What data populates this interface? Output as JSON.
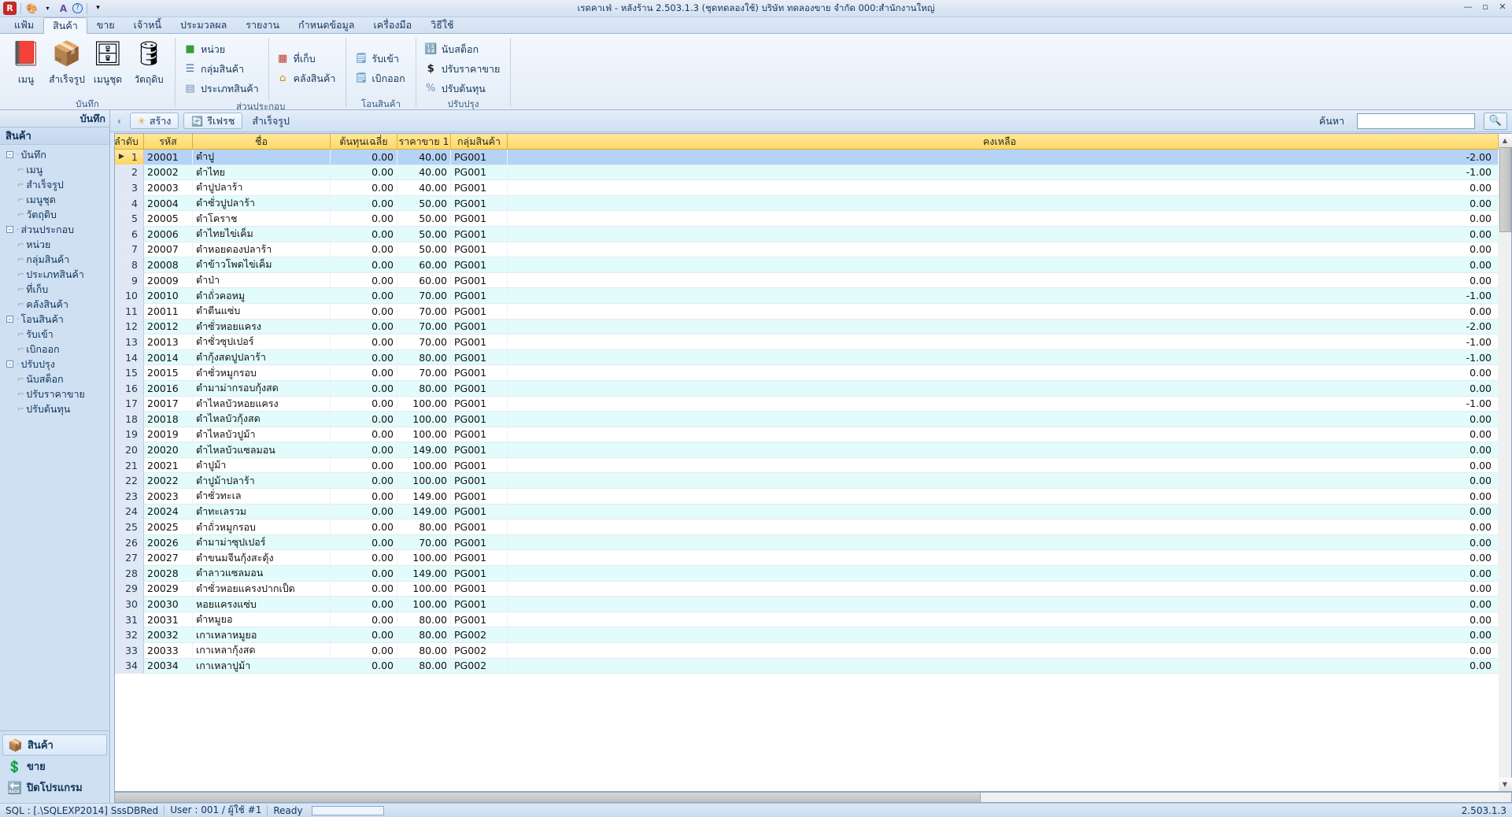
{
  "window": {
    "title": "เรดคาเฟ่ - หลังร้าน 2.503.1.3 (ชุดทดลองใช้) บริษัท ทดลองขาย จำกัด 000:สำนักงานใหญ่",
    "minimize": "—",
    "maximize": "▫",
    "close": "✕"
  },
  "quick_access": {
    "app_icon": "R",
    "items": [
      {
        "name": "palette-icon",
        "glyph": "🎨"
      },
      {
        "name": "dropdown-arrow-icon",
        "glyph": "▾"
      },
      {
        "name": "font-icon",
        "glyph": "A"
      },
      {
        "name": "help-icon",
        "glyph": "?"
      },
      {
        "name": "customize-qat-icon",
        "glyph": "▾"
      }
    ]
  },
  "ribbon": {
    "tabs": [
      {
        "label": "แฟ้ม",
        "active": false
      },
      {
        "label": "สินค้า",
        "active": true
      },
      {
        "label": "ขาย",
        "active": false
      },
      {
        "label": "เจ้าหนี้",
        "active": false
      },
      {
        "label": "ประมวลผล",
        "active": false
      },
      {
        "label": "รายงาน",
        "active": false
      },
      {
        "label": "กำหนดข้อมูล",
        "active": false
      },
      {
        "label": "เครื่องมือ",
        "active": false
      },
      {
        "label": "วิธีใช้",
        "active": false
      }
    ],
    "groups": [
      {
        "label": "บันทึก",
        "big_buttons": [
          {
            "label": "เมนู",
            "icon": "book-icon",
            "glyph": "📕"
          },
          {
            "label": "สำเร็จรูป",
            "icon": "box-icon",
            "glyph": "📦"
          },
          {
            "label": "เมนูชุด",
            "icon": "cabinet-icon",
            "glyph": "🗄"
          },
          {
            "label": "วัตถุดิบ",
            "icon": "cylinder-icon",
            "glyph": "🛢"
          }
        ]
      },
      {
        "label": "ส่วนประกอบ",
        "columns": [
          [
            {
              "label": "หน่วย",
              "icon": "green-square-icon",
              "glyph": "🟩"
            },
            {
              "label": "กลุ่มสินค้า",
              "icon": "list-icon",
              "glyph": "☷"
            },
            {
              "label": "ประเภทสินค้า",
              "icon": "document-list-icon",
              "glyph": "📄"
            }
          ],
          [
            {
              "label": "ที่เก็บ",
              "icon": "warehouse-icon",
              "glyph": "🏭"
            },
            {
              "label": "คลังสินค้า",
              "icon": "house-icon",
              "glyph": "🏠"
            }
          ]
        ]
      },
      {
        "label": "โอนสินค้า",
        "columns": [
          [
            {
              "label": "รับเข้า",
              "icon": "receive-icon",
              "glyph": "📝"
            },
            {
              "label": "เบิกออก",
              "icon": "issue-icon",
              "glyph": "📝"
            }
          ]
        ]
      },
      {
        "label": "ปรับปรุง",
        "columns": [
          [
            {
              "label": "นับสต็อก",
              "icon": "counter-icon",
              "glyph": "🔢"
            },
            {
              "label": "ปรับราคาขาย",
              "icon": "dollar-icon",
              "glyph": "$"
            },
            {
              "label": "ปรับต้นทุน",
              "icon": "percent-icon",
              "glyph": "%"
            }
          ]
        ]
      }
    ]
  },
  "sidebar": {
    "header": "บันทึก",
    "collapse_icon": "‹",
    "title": "สินค้า",
    "tree": [
      {
        "label": "บันทึก",
        "level": 0,
        "expander": "-"
      },
      {
        "label": "เมนู",
        "level": 1
      },
      {
        "label": "สำเร็จรูป",
        "level": 1
      },
      {
        "label": "เมนูชุด",
        "level": 1
      },
      {
        "label": "วัตถุดิบ",
        "level": 1
      },
      {
        "label": "ส่วนประกอบ",
        "level": 0,
        "expander": "-"
      },
      {
        "label": "หน่วย",
        "level": 1
      },
      {
        "label": "กลุ่มสินค้า",
        "level": 1
      },
      {
        "label": "ประเภทสินค้า",
        "level": 1
      },
      {
        "label": "ที่เก็บ",
        "level": 1
      },
      {
        "label": "คลังสินค้า",
        "level": 1
      },
      {
        "label": "โอนสินค้า",
        "level": 0,
        "expander": "-"
      },
      {
        "label": "รับเข้า",
        "level": 1
      },
      {
        "label": "เบิกออก",
        "level": 1
      },
      {
        "label": "ปรับปรุง",
        "level": 0,
        "expander": "-"
      },
      {
        "label": "นับสต็อก",
        "level": 1
      },
      {
        "label": "ปรับราคาขาย",
        "level": 1
      },
      {
        "label": "ปรับต้นทุน",
        "level": 1
      }
    ],
    "bottom_buttons": [
      {
        "label": "สินค้า",
        "icon": "box-icon",
        "glyph": "📦",
        "selected": true
      },
      {
        "label": "ขาย",
        "icon": "dollar-coin-icon",
        "glyph": "💲",
        "selected": false
      },
      {
        "label": "ปิดโปรแกรม",
        "icon": "exit-icon",
        "glyph": "🔙",
        "selected": false
      }
    ]
  },
  "toolbar": {
    "collapse_icon": "‹",
    "create_label": "สร้าง",
    "create_icon": "star-icon",
    "create_glyph": "✳",
    "refresh_label": "รีเฟรช",
    "refresh_icon": "refresh-icon",
    "refresh_glyph": "🔄",
    "context_label": "สำเร็จรูป",
    "search_label": "ค้นหา",
    "search_value": "",
    "search_placeholder": "",
    "search_button_icon": "magnifier-icon",
    "search_button_glyph": "🔍"
  },
  "grid": {
    "columns": [
      {
        "key": "idx",
        "label": "ลำดับ"
      },
      {
        "key": "code",
        "label": "รหัส"
      },
      {
        "key": "name",
        "label": "ชื่อ"
      },
      {
        "key": "cost",
        "label": "ต้นทุนเฉลี่ย"
      },
      {
        "key": "price",
        "label": "ราคาขาย 1"
      },
      {
        "key": "group",
        "label": "กลุ่มสินค้า"
      },
      {
        "key": "stock",
        "label": "คงเหลือ"
      }
    ],
    "rows": [
      {
        "idx": "1",
        "code": "20001",
        "name": "ตำปู",
        "cost": "0.00",
        "price": "40.00",
        "group": "PG001",
        "stock": "-2.00",
        "selected": true
      },
      {
        "idx": "2",
        "code": "20002",
        "name": "ตำไทย",
        "cost": "0.00",
        "price": "40.00",
        "group": "PG001",
        "stock": "-1.00"
      },
      {
        "idx": "3",
        "code": "20003",
        "name": "ตำปูปลาร้า",
        "cost": "0.00",
        "price": "40.00",
        "group": "PG001",
        "stock": "0.00"
      },
      {
        "idx": "4",
        "code": "20004",
        "name": "ตำซั่วปูปลาร้า",
        "cost": "0.00",
        "price": "50.00",
        "group": "PG001",
        "stock": "0.00"
      },
      {
        "idx": "5",
        "code": "20005",
        "name": "ตำโคราช",
        "cost": "0.00",
        "price": "50.00",
        "group": "PG001",
        "stock": "0.00"
      },
      {
        "idx": "6",
        "code": "20006",
        "name": "ตำไทยไข่เค็ม",
        "cost": "0.00",
        "price": "50.00",
        "group": "PG001",
        "stock": "0.00"
      },
      {
        "idx": "7",
        "code": "20007",
        "name": "ตำหอยดองปลาร้า",
        "cost": "0.00",
        "price": "50.00",
        "group": "PG001",
        "stock": "0.00"
      },
      {
        "idx": "8",
        "code": "20008",
        "name": "ตำข้าวโพดไข่เค็ม",
        "cost": "0.00",
        "price": "60.00",
        "group": "PG001",
        "stock": "0.00"
      },
      {
        "idx": "9",
        "code": "20009",
        "name": "ตำป่า",
        "cost": "0.00",
        "price": "60.00",
        "group": "PG001",
        "stock": "0.00"
      },
      {
        "idx": "10",
        "code": "20010",
        "name": "ตำถั่วคอหมู",
        "cost": "0.00",
        "price": "70.00",
        "group": "PG001",
        "stock": "-1.00"
      },
      {
        "idx": "11",
        "code": "20011",
        "name": "ตำตีนแซ่บ",
        "cost": "0.00",
        "price": "70.00",
        "group": "PG001",
        "stock": "0.00"
      },
      {
        "idx": "12",
        "code": "20012",
        "name": "ตำซั่วหอยแครง",
        "cost": "0.00",
        "price": "70.00",
        "group": "PG001",
        "stock": "-2.00"
      },
      {
        "idx": "13",
        "code": "20013",
        "name": "ตำซั่วซุปเปอร์",
        "cost": "0.00",
        "price": "70.00",
        "group": "PG001",
        "stock": "-1.00"
      },
      {
        "idx": "14",
        "code": "20014",
        "name": "ตำกุ้งสดปูปลาร้า",
        "cost": "0.00",
        "price": "80.00",
        "group": "PG001",
        "stock": "-1.00"
      },
      {
        "idx": "15",
        "code": "20015",
        "name": "ตำซั่วหมูกรอบ",
        "cost": "0.00",
        "price": "70.00",
        "group": "PG001",
        "stock": "0.00"
      },
      {
        "idx": "16",
        "code": "20016",
        "name": "ตำมาม่ากรอบกุ้งสด",
        "cost": "0.00",
        "price": "80.00",
        "group": "PG001",
        "stock": "0.00"
      },
      {
        "idx": "17",
        "code": "20017",
        "name": "ตำไหลบัวหอยแครง",
        "cost": "0.00",
        "price": "100.00",
        "group": "PG001",
        "stock": "-1.00"
      },
      {
        "idx": "18",
        "code": "20018",
        "name": "ตำไหลบัวกุ้งสด",
        "cost": "0.00",
        "price": "100.00",
        "group": "PG001",
        "stock": "0.00"
      },
      {
        "idx": "19",
        "code": "20019",
        "name": "ตำไหลบัวปูม้า",
        "cost": "0.00",
        "price": "100.00",
        "group": "PG001",
        "stock": "0.00"
      },
      {
        "idx": "20",
        "code": "20020",
        "name": "ตำไหลบัวแซลมอน",
        "cost": "0.00",
        "price": "149.00",
        "group": "PG001",
        "stock": "0.00"
      },
      {
        "idx": "21",
        "code": "20021",
        "name": "ตำปูม้า",
        "cost": "0.00",
        "price": "100.00",
        "group": "PG001",
        "stock": "0.00"
      },
      {
        "idx": "22",
        "code": "20022",
        "name": "ตำปูม้าปลาร้า",
        "cost": "0.00",
        "price": "100.00",
        "group": "PG001",
        "stock": "0.00"
      },
      {
        "idx": "23",
        "code": "20023",
        "name": "ตำซั่วทะเล",
        "cost": "0.00",
        "price": "149.00",
        "group": "PG001",
        "stock": "0.00"
      },
      {
        "idx": "24",
        "code": "20024",
        "name": "ตำทะเลรวม",
        "cost": "0.00",
        "price": "149.00",
        "group": "PG001",
        "stock": "0.00"
      },
      {
        "idx": "25",
        "code": "20025",
        "name": "ตำถั่วหมูกรอบ",
        "cost": "0.00",
        "price": "80.00",
        "group": "PG001",
        "stock": "0.00"
      },
      {
        "idx": "26",
        "code": "20026",
        "name": "ตำมาม่าซุปเปอร์",
        "cost": "0.00",
        "price": "70.00",
        "group": "PG001",
        "stock": "0.00"
      },
      {
        "idx": "27",
        "code": "20027",
        "name": "ตำขนมจีนกุ้งสะดุ้ง",
        "cost": "0.00",
        "price": "100.00",
        "group": "PG001",
        "stock": "0.00"
      },
      {
        "idx": "28",
        "code": "20028",
        "name": "ตำลาวแซลมอน",
        "cost": "0.00",
        "price": "149.00",
        "group": "PG001",
        "stock": "0.00"
      },
      {
        "idx": "29",
        "code": "20029",
        "name": "ตำซั่วหอยแครงปากเป็ด",
        "cost": "0.00",
        "price": "100.00",
        "group": "PG001",
        "stock": "0.00"
      },
      {
        "idx": "30",
        "code": "20030",
        "name": "หอยแครงแซ่บ",
        "cost": "0.00",
        "price": "100.00",
        "group": "PG001",
        "stock": "0.00"
      },
      {
        "idx": "31",
        "code": "20031",
        "name": "ตำหมูยอ",
        "cost": "0.00",
        "price": "80.00",
        "group": "PG001",
        "stock": "0.00"
      },
      {
        "idx": "32",
        "code": "20032",
        "name": "เกาเหลาหมูยอ",
        "cost": "0.00",
        "price": "80.00",
        "group": "PG002",
        "stock": "0.00"
      },
      {
        "idx": "33",
        "code": "20033",
        "name": "เกาเหลากุ้งสด",
        "cost": "0.00",
        "price": "80.00",
        "group": "PG002",
        "stock": "0.00"
      },
      {
        "idx": "34",
        "code": "20034",
        "name": "เกาเหลาปูม้า",
        "cost": "0.00",
        "price": "80.00",
        "group": "PG002",
        "stock": "0.00"
      }
    ]
  },
  "statusbar": {
    "sql": "SQL : [.\\SQLEXP2014] SssDBRed",
    "user": "User : 001 / ผู้ใช้ #1",
    "state": "Ready",
    "version": "2.503.1.3"
  }
}
